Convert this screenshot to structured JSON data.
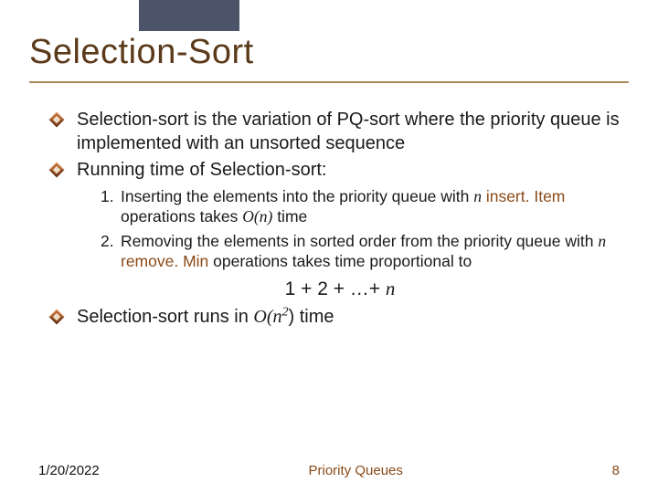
{
  "title": "Selection-Sort",
  "bullets": {
    "b1": "Selection-sort is the variation of PQ-sort where the priority queue is implemented with an unsorted sequence",
    "b2": "Running time of Selection-sort:",
    "b3_pre": "Selection-sort runs in ",
    "b3_bigO": "O(n",
    "b3_exp": "2",
    "b3_post": ") time"
  },
  "sub": {
    "s1_a": "Inserting the elements into the priority queue with ",
    "s1_n": "n",
    "s1_b_brown": "insert. Item",
    "s1_b_rest": " operations takes ",
    "s1_c": "O(n)",
    "s1_d": " time",
    "s2_a": "Removing the elements in sorted order from the priority queue with ",
    "s2_n": "n",
    "s2_b_brown": " remove. Min",
    "s2_b_rest": " operations takes time proportional to"
  },
  "formula": {
    "pre": "1 + 2 + …+ ",
    "n": "n"
  },
  "footer": {
    "date": "1/20/2022",
    "center": "Priority Queues",
    "page": "8"
  }
}
